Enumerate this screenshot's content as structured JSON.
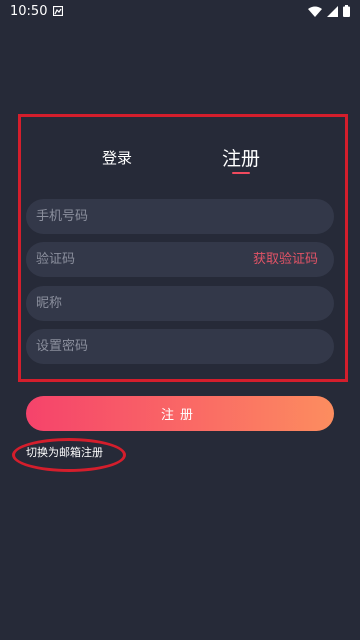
{
  "status_bar": {
    "time": "10:50",
    "icons": [
      "notification-icon",
      "wifi-icon",
      "signal-icon",
      "battery-icon"
    ]
  },
  "tabs": [
    {
      "label": "登录",
      "active": false
    },
    {
      "label": "注册",
      "active": true
    }
  ],
  "form": {
    "phone_placeholder": "手机号码",
    "code_placeholder": "验证码",
    "get_code_label": "获取验证码",
    "nickname_placeholder": "昵称",
    "password_placeholder": "设置密码"
  },
  "submit_label": "注册",
  "switch_email_label": "切换为邮箱注册",
  "colors": {
    "background": "#262a38",
    "field": "#333849",
    "accent": "#e25366",
    "gradient_start": "#f5436b",
    "gradient_end": "#fc8d5f",
    "annotation": "#d41e2c"
  }
}
